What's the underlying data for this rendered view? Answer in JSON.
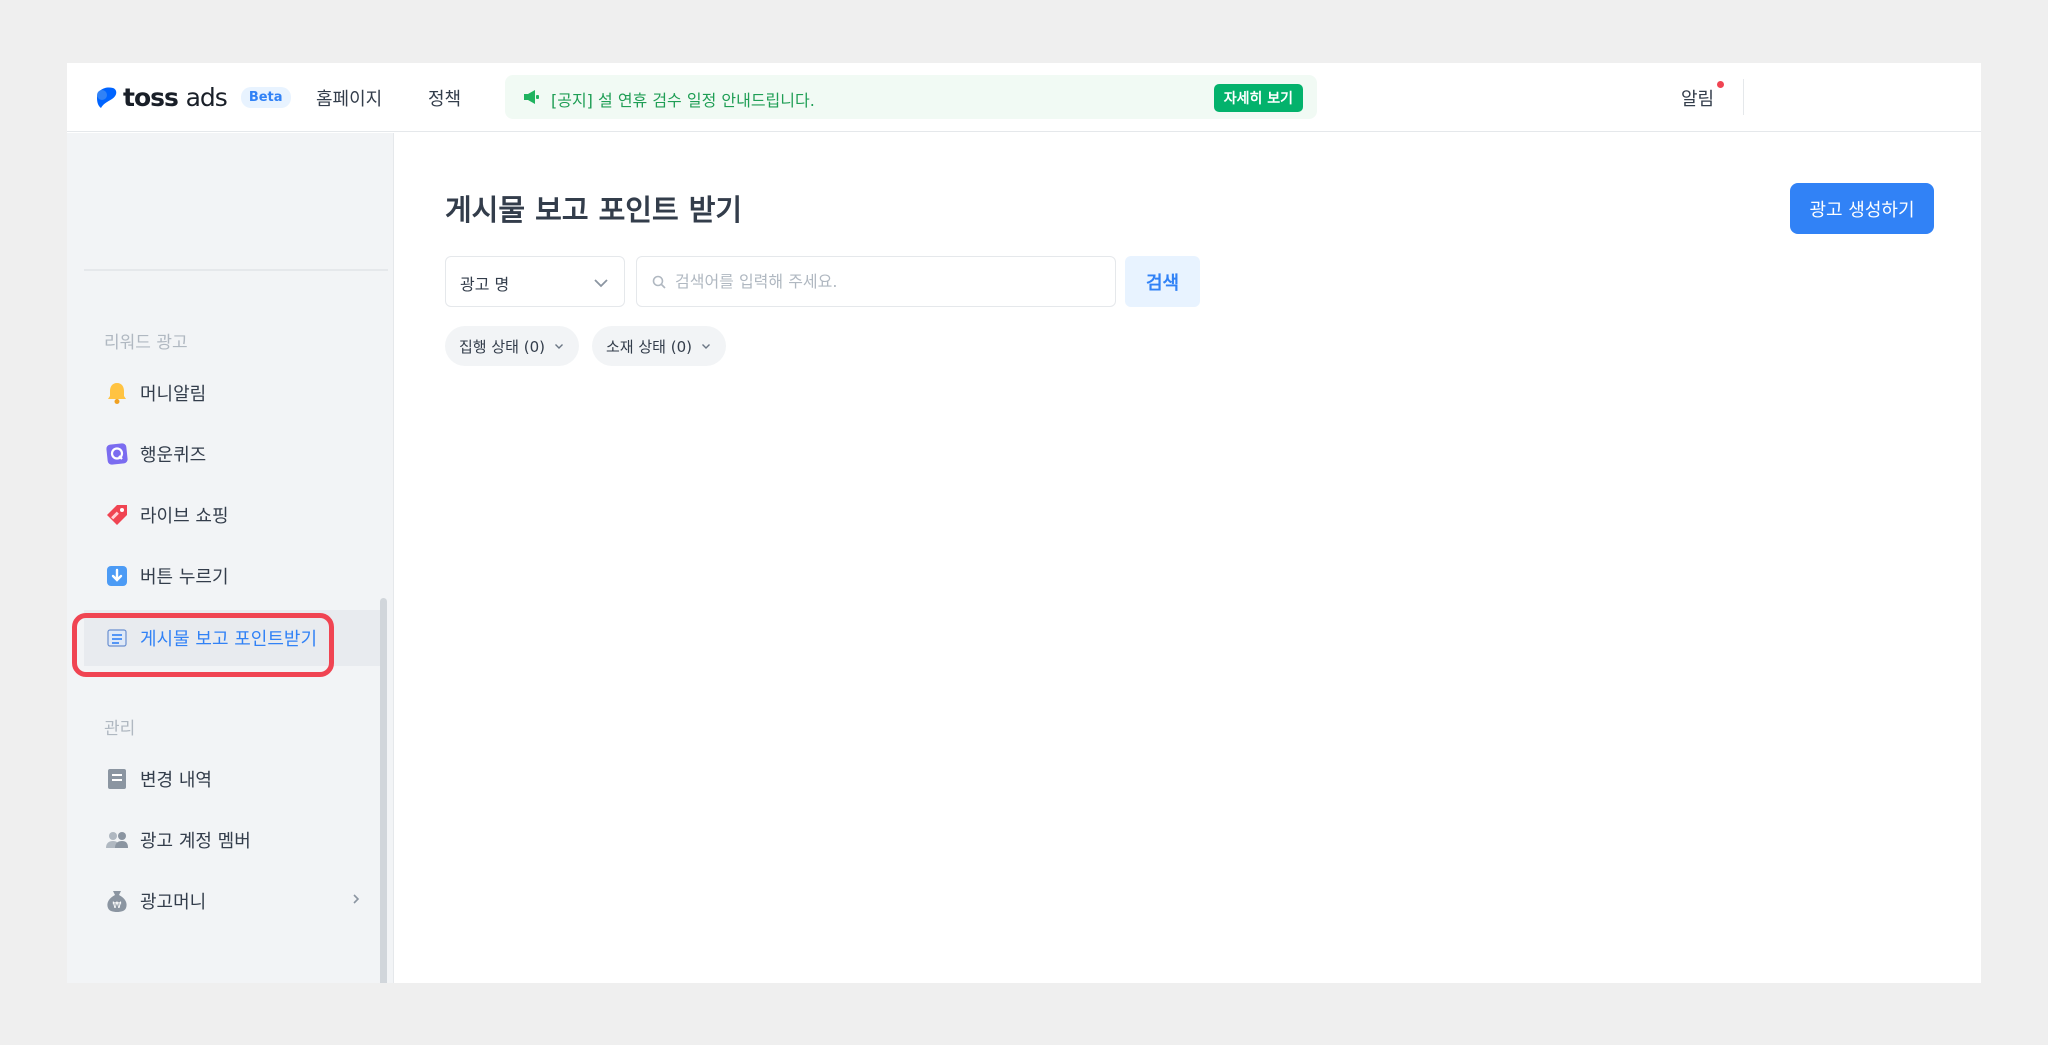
{
  "header": {
    "logo_toss": "toss",
    "logo_ads": "ads",
    "beta_label": "Beta",
    "nav": [
      "홈페이지",
      "정책"
    ],
    "notice_text": "[공지] 설 연휴 검수 일정 안내드립니다.",
    "notice_button": "자세히 보기",
    "alarm_label": "알림"
  },
  "sidebar": {
    "reward_section": "리워드 광고",
    "reward_items": [
      "머니알림",
      "행운퀴즈",
      "라이브 쇼핑",
      "버튼 누르기",
      "게시물 보고 포인트받기"
    ],
    "manage_section": "관리",
    "manage_items": [
      "변경 내역",
      "광고 계정 멤버",
      "광고머니"
    ]
  },
  "main": {
    "title": "게시물 보고 포인트 받기",
    "create_button": "광고 생성하기",
    "select_value": "광고 명",
    "search_placeholder": "검색어를 입력해 주세요.",
    "search_button": "검색",
    "filters": [
      "집행 상태 (0)",
      "소재 상태 (0)"
    ]
  },
  "colors": {
    "accent": "#3182f6",
    "notice_bg": "#f1faf4",
    "notice_button": "#03b26c",
    "highlight": "#f04452"
  }
}
